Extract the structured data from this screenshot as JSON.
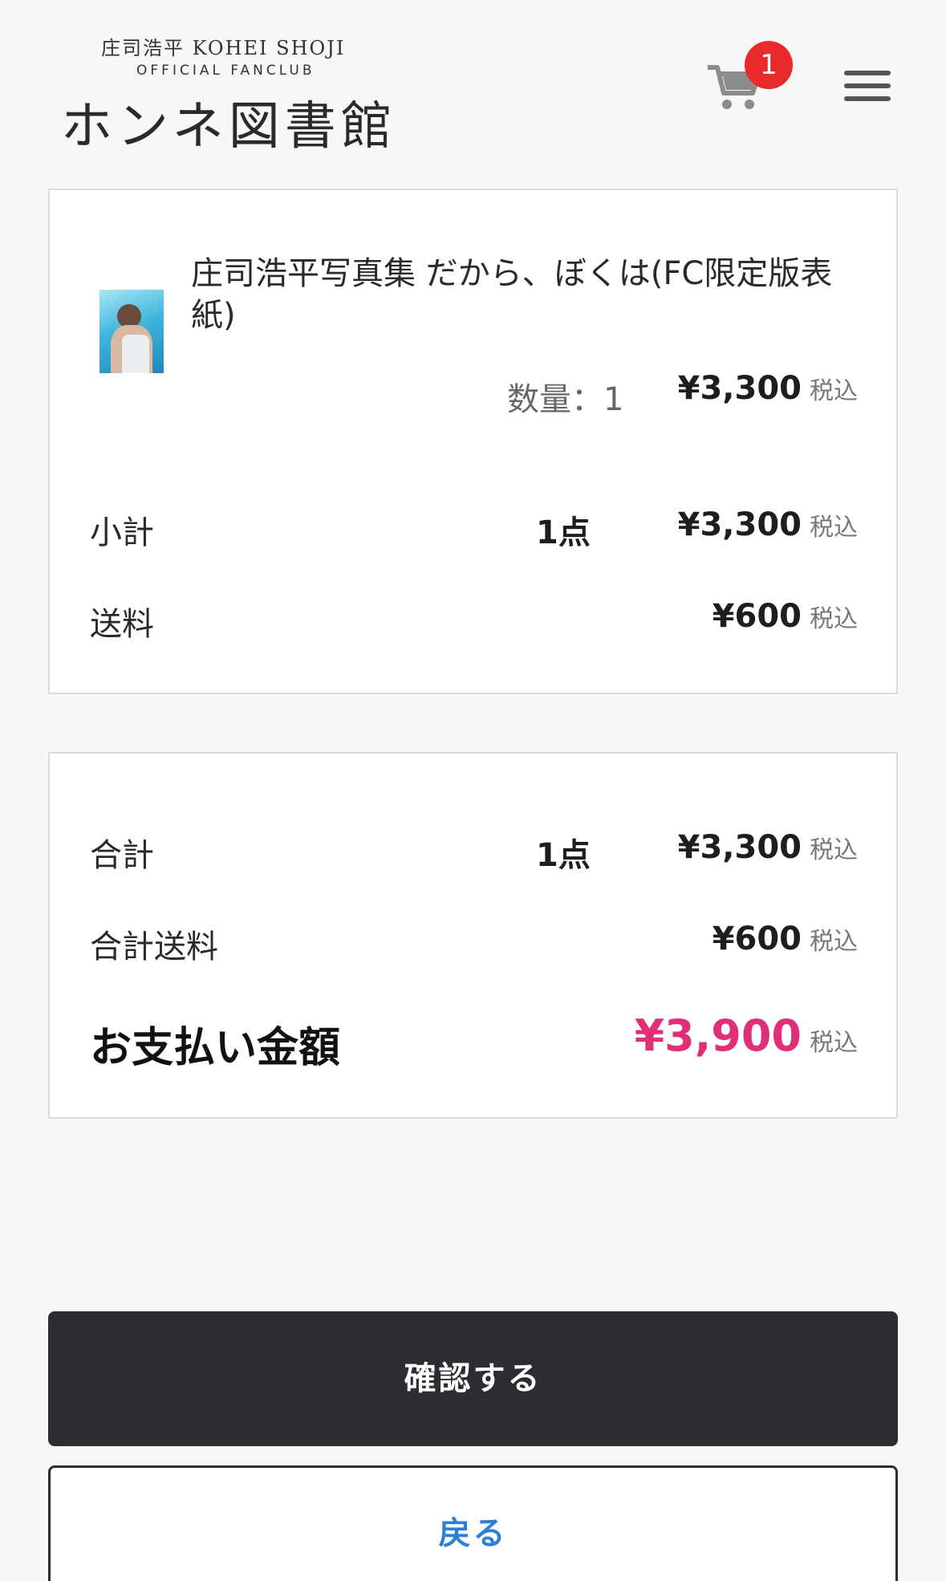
{
  "header": {
    "logo_top": "庄司浩平 KOHEI SHOJI",
    "logo_mid": "OFFICIAL FANCLUB",
    "logo_main": "ホンネ図書館",
    "cart_count": "1"
  },
  "item": {
    "title": "庄司浩平写真集 だから、ぼくは(FC限定版表紙)",
    "quantity_text": "数量：1",
    "price": "¥3,300",
    "tax_label": "税込"
  },
  "subtotal": {
    "label": "小計",
    "count": "1点",
    "price": "¥3,300",
    "tax_label": "税込"
  },
  "shipping": {
    "label": "送料",
    "price": "¥600",
    "tax_label": "税込"
  },
  "total": {
    "label": "合計",
    "count": "1点",
    "price": "¥3,300",
    "tax_label": "税込"
  },
  "total_shipping": {
    "label": "合計送料",
    "price": "¥600",
    "tax_label": "税込"
  },
  "payment": {
    "label": "お支払い金額",
    "price": "¥3,900",
    "tax_label": "税込",
    "price_color": "#e02f77"
  },
  "buttons": {
    "confirm_label": "確認する",
    "back_label": "戻る"
  }
}
